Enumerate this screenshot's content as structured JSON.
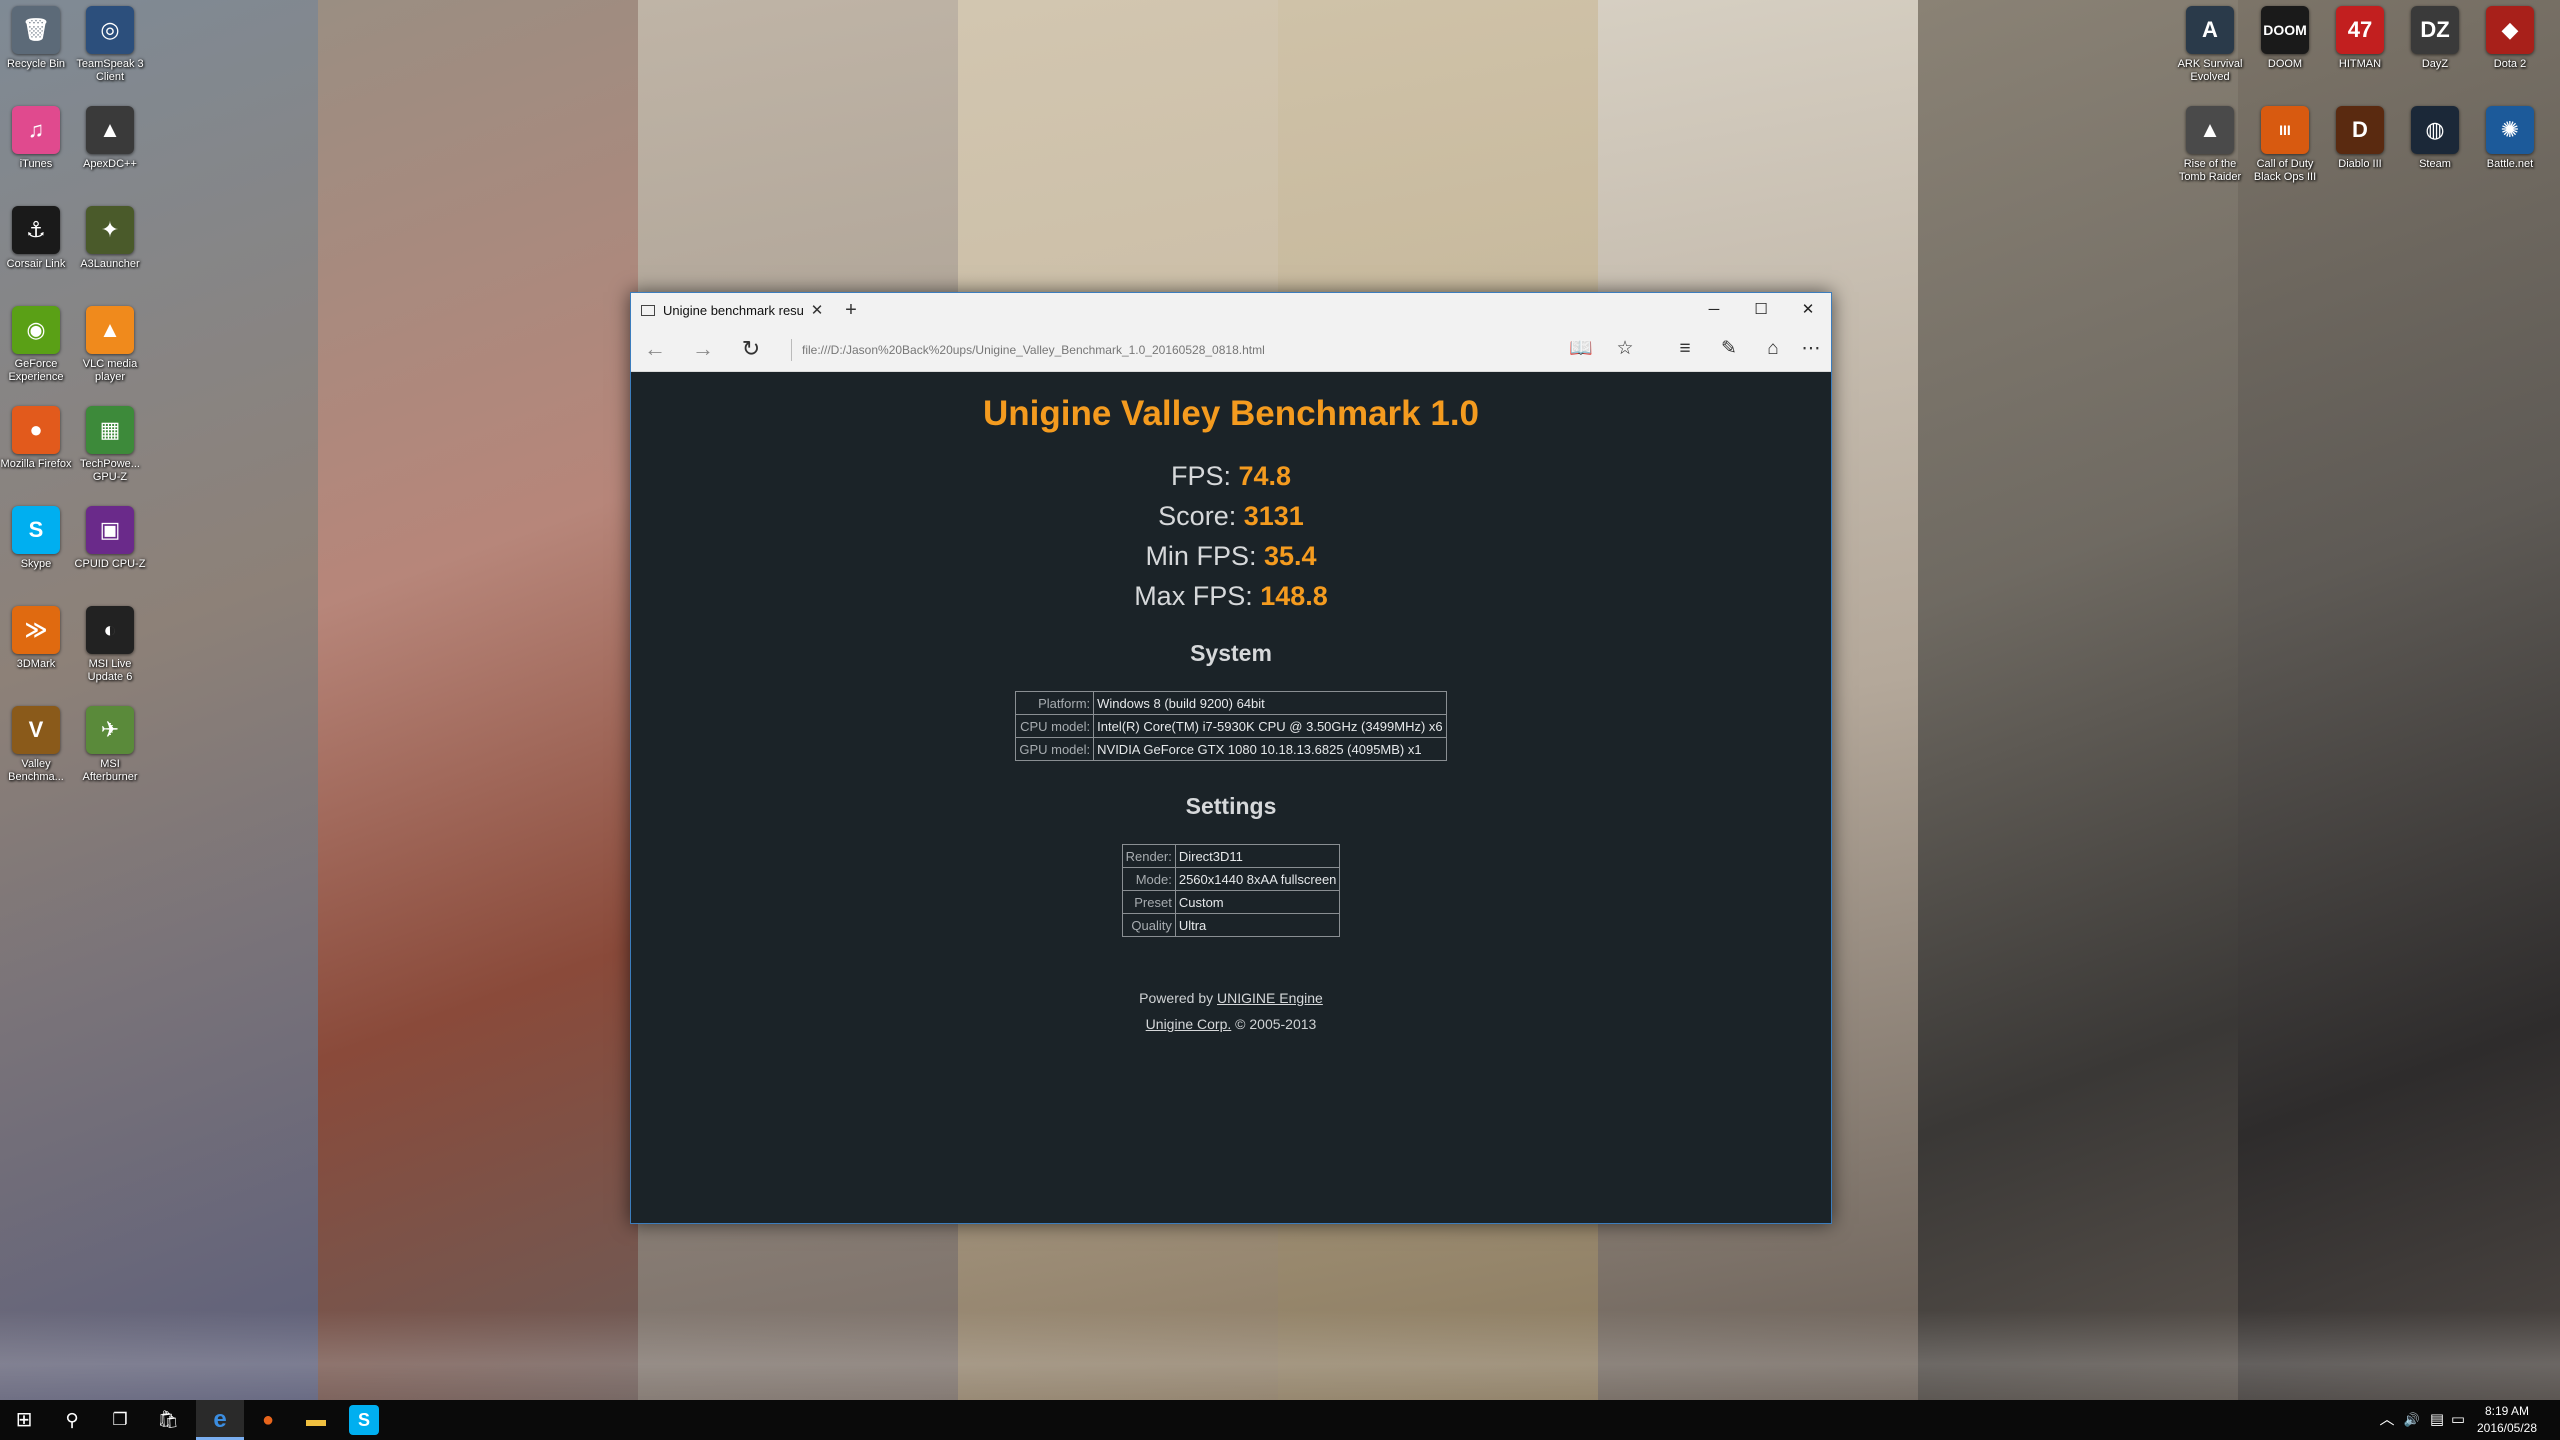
{
  "desktop": {
    "left_icons": [
      {
        "label": "Recycle Bin",
        "icon": "recycle-bin-icon",
        "glyph": "🗑",
        "color": "#5c6a78"
      },
      {
        "label": "TeamSpeak 3 Client",
        "icon": "teamspeak-icon",
        "glyph": "◎",
        "color": "#2c4f7c"
      },
      {
        "label": "iTunes",
        "icon": "itunes-icon",
        "glyph": "♫",
        "color": "#e04a8e"
      },
      {
        "label": "ApexDC++",
        "icon": "apexdc-icon",
        "glyph": "▲",
        "color": "#3a3a3a"
      },
      {
        "label": "Corsair Link",
        "icon": "corsair-link-icon",
        "glyph": "⚓",
        "color": "#1a1a1a"
      },
      {
        "label": "A3Launcher",
        "icon": "a3launcher-icon",
        "glyph": "✦",
        "color": "#4a5a2a"
      },
      {
        "label": "GeForce Experience",
        "icon": "geforce-icon",
        "glyph": "◉",
        "color": "#5aa016"
      },
      {
        "label": "VLC media player",
        "icon": "vlc-icon",
        "glyph": "▲",
        "color": "#f08a1c"
      },
      {
        "label": "Mozilla Firefox",
        "icon": "firefox-icon",
        "glyph": "●",
        "color": "#e25a1c"
      },
      {
        "label": "TechPowe... GPU-Z",
        "icon": "gpu-z-icon",
        "glyph": "▦",
        "color": "#3d8a3a"
      },
      {
        "label": "Skype",
        "icon": "skype-icon",
        "glyph": "S",
        "color": "#00aff0"
      },
      {
        "label": "CPUID CPU-Z",
        "icon": "cpu-z-icon",
        "glyph": "▣",
        "color": "#6a2a8a"
      },
      {
        "label": "3DMark",
        "icon": "3dmark-icon",
        "glyph": "≫",
        "color": "#e06a10"
      },
      {
        "label": "MSI Live Update 6",
        "icon": "msi-live-update-icon",
        "glyph": "◐",
        "color": "#222222"
      },
      {
        "label": "Valley Benchma...",
        "icon": "valley-benchmark-icon",
        "glyph": "V",
        "color": "#8a5a1a"
      },
      {
        "label": "MSI Afterburner",
        "icon": "msi-afterburner-icon",
        "glyph": "✈",
        "color": "#5a8a3a"
      }
    ],
    "right_icons": [
      {
        "label": "ARK Survival Evolved",
        "icon": "ark-icon",
        "glyph": "A",
        "color": "#2a3a4a"
      },
      {
        "label": "DOOM",
        "icon": "doom-icon",
        "glyph": "DOOM",
        "color": "#1a1a1a"
      },
      {
        "label": "HITMAN",
        "icon": "hitman-icon",
        "glyph": "47",
        "color": "#c21f1f"
      },
      {
        "label": "DayZ",
        "icon": "dayz-icon",
        "glyph": "DZ",
        "color": "#3a3a3a"
      },
      {
        "label": "Dota 2",
        "icon": "dota2-icon",
        "glyph": "◆",
        "color": "#a8201a"
      },
      {
        "label": "Rise of the Tomb Raider",
        "icon": "tomb-raider-icon",
        "glyph": "▲",
        "color": "#4a4a4a"
      },
      {
        "label": "Call of Duty Black Ops III",
        "icon": "black-ops-icon",
        "glyph": "III",
        "color": "#d85a10"
      },
      {
        "label": "Diablo III",
        "icon": "diablo-icon",
        "glyph": "D",
        "color": "#5a2a10"
      },
      {
        "label": "Steam",
        "icon": "steam-icon",
        "glyph": "◍",
        "color": "#1b2838"
      },
      {
        "label": "Battle.net",
        "icon": "battlenet-icon",
        "glyph": "✺",
        "color": "#1c5a9a"
      }
    ]
  },
  "browser": {
    "tab_title": "Unigine benchmark resu",
    "tab_close": "✕",
    "new_tab": "+",
    "minimize": "─",
    "maximize": "☐",
    "close": "✕",
    "back": "←",
    "forward": "→",
    "refresh": "↻",
    "url": "file:///D:/Jason%20Back%20ups/Unigine_Valley_Benchmark_1.0_20160528_0818.html",
    "reading_view": "📖",
    "favorite": "☆",
    "hub": "≡",
    "web_note": "✎",
    "share": "⌂",
    "more": "⋯"
  },
  "report": {
    "title": "Unigine Valley Benchmark 1.0",
    "stats": [
      {
        "label": "FPS:",
        "value": "74.8"
      },
      {
        "label": "Score:",
        "value": "3131"
      },
      {
        "label": "Min FPS:",
        "value": "35.4"
      },
      {
        "label": "Max FPS:",
        "value": "148.8"
      }
    ],
    "system_heading": "System",
    "system": [
      {
        "key": "Platform:",
        "value": "Windows 8 (build 9200) 64bit"
      },
      {
        "key": "CPU model:",
        "value": "Intel(R) Core(TM) i7-5930K CPU @ 3.50GHz (3499MHz) x6"
      },
      {
        "key": "GPU model:",
        "value": "NVIDIA GeForce GTX 1080 10.18.13.6825 (4095MB) x1"
      }
    ],
    "settings_heading": "Settings",
    "settings": [
      {
        "key": "Render:",
        "value": "Direct3D11"
      },
      {
        "key": "Mode:",
        "value": "2560x1440 8xAA fullscreen"
      },
      {
        "key": "Preset",
        "value": "Custom"
      },
      {
        "key": "Quality",
        "value": "Ultra"
      }
    ],
    "footer_powered": "Powered by ",
    "footer_engine_link": "UNIGINE Engine",
    "footer_corp_link": "Unigine Corp.",
    "footer_copyright": " © 2005-2013"
  },
  "taskbar": {
    "start": "⊞",
    "search": "⚲",
    "task_view": "❐",
    "store": "🛍",
    "edge": "e",
    "firefox": "●",
    "explorer": "▬",
    "skype": "S",
    "tray_chevron": "︿",
    "tray_volume": "🔊",
    "tray_network": "▤",
    "tray_notifications": "▭",
    "time": "8:19 AM",
    "date": "2016/05/28"
  },
  "colors": {
    "accent_orange": "#f49b1f",
    "report_bg": "#1b2328",
    "window_border": "#3c7dbd"
  }
}
